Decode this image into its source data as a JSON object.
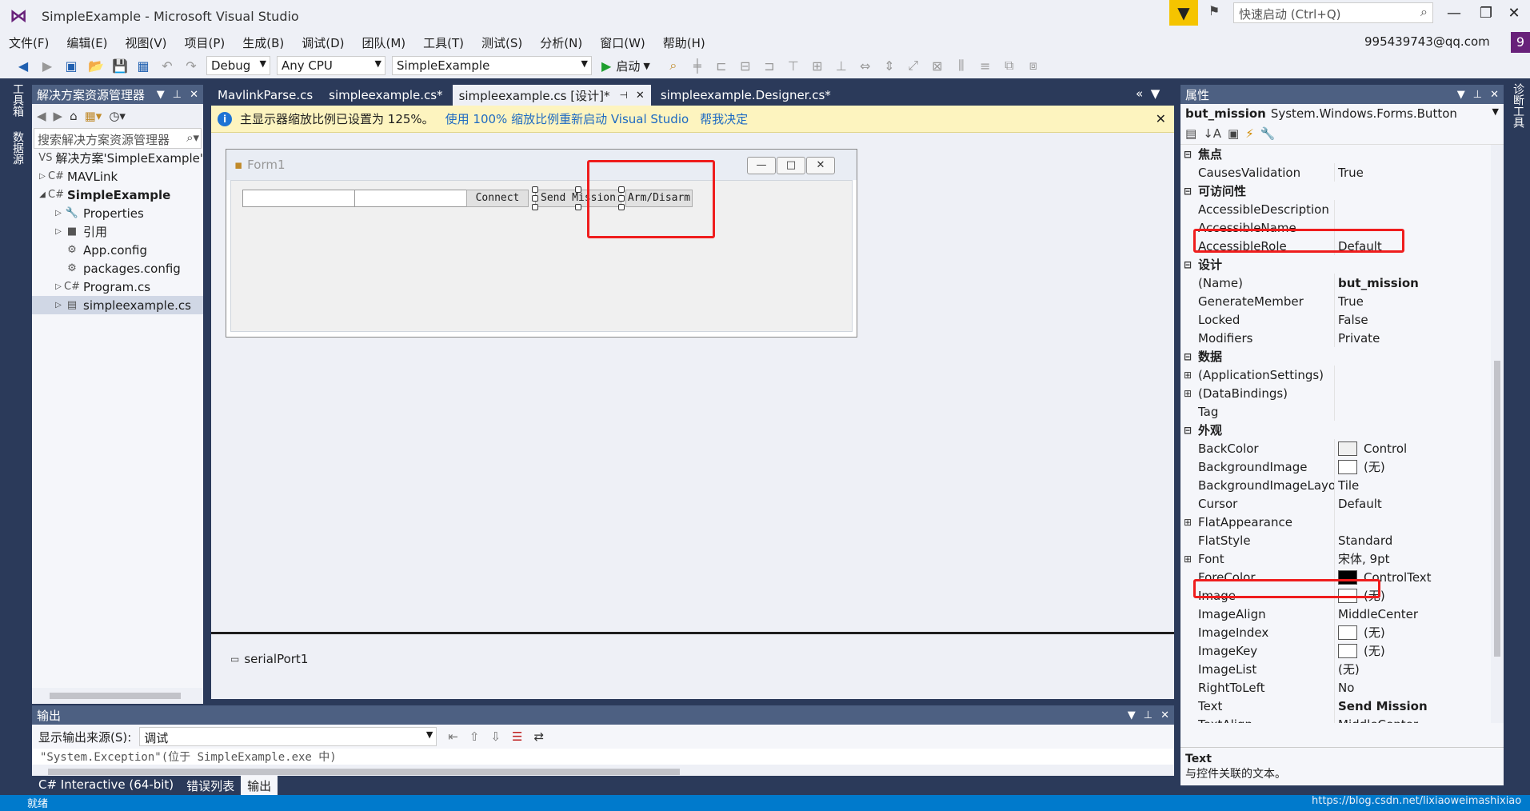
{
  "window": {
    "title": "SimpleExample - Microsoft Visual Studio",
    "quick_launch": "快速启动 (Ctrl+Q)",
    "user": "995439743@qq.com",
    "user_badge": "9"
  },
  "menu": [
    "文件(F)",
    "编辑(E)",
    "视图(V)",
    "项目(P)",
    "生成(B)",
    "调试(D)",
    "团队(M)",
    "工具(T)",
    "测试(S)",
    "分析(N)",
    "窗口(W)",
    "帮助(H)"
  ],
  "toolbar": {
    "config": "Debug",
    "platform": "Any CPU",
    "project": "SimpleExample",
    "start_label": "启动"
  },
  "side_tabs": {
    "left1": "工具箱",
    "left2": "数据源",
    "right1": "诊断工具"
  },
  "solution_explorer": {
    "title": "解决方案资源管理器",
    "search_placeholder": "搜索解决方案资源管理器",
    "items": [
      {
        "label": "解决方案'SimpleExample'",
        "icon": "VS",
        "expander": "",
        "indent": 0
      },
      {
        "label": "MAVLink",
        "icon": "C#",
        "expander": "▷",
        "indent": 0
      },
      {
        "label": "SimpleExample",
        "icon": "C#",
        "expander": "◢",
        "indent": 0
      },
      {
        "label": "Properties",
        "icon": "🔧",
        "expander": "▷",
        "indent": 1
      },
      {
        "label": "引用",
        "icon": "■",
        "expander": "▷",
        "indent": 1
      },
      {
        "label": "App.config",
        "icon": "⚙",
        "expander": "",
        "indent": 1
      },
      {
        "label": "packages.config",
        "icon": "⚙",
        "expander": "",
        "indent": 1
      },
      {
        "label": "Program.cs",
        "icon": "C#",
        "expander": "▷",
        "indent": 1
      },
      {
        "label": "simpleexample.cs",
        "icon": "▤",
        "expander": "▷",
        "indent": 1
      }
    ]
  },
  "doc_tabs": [
    "MavlinkParse.cs",
    "simpleexample.cs*",
    "simpleexample.cs [设计]*",
    "simpleexample.Designer.cs*"
  ],
  "infobar": {
    "message": "主显示器缩放比例已设置为 125%。",
    "link1": "使用 100% 缩放比例重新启动 Visual Studio",
    "link2": "帮我决定"
  },
  "form_designer": {
    "form_title": "Form1",
    "buttons": {
      "connect": "Connect",
      "send_mission": "Send Mission",
      "arm": "Arm/Disarm"
    },
    "tray_component": "serialPort1"
  },
  "properties": {
    "title": "属性",
    "object_name": "but_mission",
    "object_type": "System.Windows.Forms.Button",
    "rows": [
      {
        "type": "cat",
        "name": "焦点",
        "value": ""
      },
      {
        "type": "prop",
        "name": "CausesValidation",
        "value": "True"
      },
      {
        "type": "cat",
        "name": "可访问性",
        "value": ""
      },
      {
        "type": "prop",
        "name": "AccessibleDescription",
        "value": ""
      },
      {
        "type": "prop",
        "name": "AccessibleName",
        "value": ""
      },
      {
        "type": "prop",
        "name": "AccessibleRole",
        "value": "Default"
      },
      {
        "type": "cat",
        "name": "设计",
        "value": ""
      },
      {
        "type": "prop",
        "name": "(Name)",
        "value": "but_mission",
        "bold": true
      },
      {
        "type": "prop",
        "name": "GenerateMember",
        "value": "True"
      },
      {
        "type": "prop",
        "name": "Locked",
        "value": "False"
      },
      {
        "type": "prop",
        "name": "Modifiers",
        "value": "Private"
      },
      {
        "type": "cat",
        "name": "数据",
        "value": ""
      },
      {
        "type": "prop",
        "name": "(ApplicationSettings)",
        "value": "",
        "expander": "⊞"
      },
      {
        "type": "prop",
        "name": "(DataBindings)",
        "value": "",
        "expander": "⊞"
      },
      {
        "type": "prop",
        "name": "Tag",
        "value": ""
      },
      {
        "type": "cat",
        "name": "外观",
        "value": ""
      },
      {
        "type": "prop",
        "name": "BackColor",
        "value": "Control",
        "swatch": "#f0f0f0"
      },
      {
        "type": "prop",
        "name": "BackgroundImage",
        "value": "(无)",
        "swatch": "#ffffff"
      },
      {
        "type": "prop",
        "name": "BackgroundImageLayout",
        "value": "Tile"
      },
      {
        "type": "prop",
        "name": "Cursor",
        "value": "Default"
      },
      {
        "type": "prop",
        "name": "FlatAppearance",
        "value": "",
        "expander": "⊞"
      },
      {
        "type": "prop",
        "name": "FlatStyle",
        "value": "Standard"
      },
      {
        "type": "prop",
        "name": "Font",
        "value": "宋体, 9pt",
        "expander": "⊞"
      },
      {
        "type": "prop",
        "name": "ForeColor",
        "value": "ControlText",
        "swatch": "#000000"
      },
      {
        "type": "prop",
        "name": "Image",
        "value": "(无)",
        "swatch": "#ffffff"
      },
      {
        "type": "prop",
        "name": "ImageAlign",
        "value": "MiddleCenter"
      },
      {
        "type": "prop",
        "name": "ImageIndex",
        "value": "(无)",
        "swatch": "#ffffff"
      },
      {
        "type": "prop",
        "name": "ImageKey",
        "value": "(无)",
        "swatch": "#ffffff"
      },
      {
        "type": "prop",
        "name": "ImageList",
        "value": "(无)"
      },
      {
        "type": "prop",
        "name": "RightToLeft",
        "value": "No"
      },
      {
        "type": "prop",
        "name": "Text",
        "value": "Send Mission",
        "bold": true
      },
      {
        "type": "prop",
        "name": "TextAlign",
        "value": "MiddleCenter"
      }
    ],
    "desc_title": "Text",
    "desc_text": "与控件关联的文本。"
  },
  "output": {
    "title": "输出",
    "source_label": "显示输出来源(S):",
    "source_value": "调试",
    "text": "\"System.Exception\"(位于 SimpleExample.exe 中)"
  },
  "bottom_tabs": [
    "C# Interactive (64-bit)",
    "错误列表",
    "输出"
  ],
  "status": {
    "text": "就绪",
    "watermark": "https://blog.csdn.net/lixiaoweimashixiao"
  },
  "colors": {
    "accent": "#007acc",
    "highlight": "#ef1d1d",
    "panel_header": "#4d6082"
  }
}
